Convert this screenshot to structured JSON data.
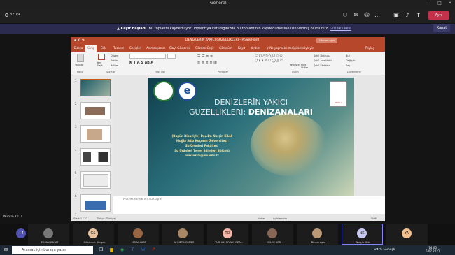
{
  "teams": {
    "window_title": "General",
    "timer": "32:19",
    "leave_label": "Ayrıl",
    "recording_bold": "Kayıt başladı.",
    "recording_text": "Bu toplantıı kaydediliyor. Toplantıya katıldığınızda bu toplantının kaydedilmesine izin vermiş olursunuz.",
    "recording_link": "Gizlilik ilkesi",
    "recording_close": "Kapat"
  },
  "ppt": {
    "title": "DENİZLERİN YAKICI GÜZELLİKLERİ - PowerPoint",
    "signin": "Oturum açın",
    "tabs": [
      "Dosya",
      "Giriş",
      "Ekle",
      "Tasarım",
      "Geçişler",
      "Animasyonlar",
      "Slayt Gösterisi",
      "Gözden Geçir",
      "Görünüm",
      "Kayıt",
      "Yardım"
    ],
    "search_hint": "Ne yapmak istediğinizi söyleyin",
    "share": "Paylaş",
    "ribbon_groups": [
      "Pano",
      "Slaytlar",
      "Yazı Tipi",
      "Paragraf",
      "Çizim",
      "Düzenleme"
    ],
    "ribbon_buttons": {
      "paste": "Yapıştır",
      "new_slide": "Yeni Slayt",
      "layout": "Düzen",
      "reset": "Sıfırla",
      "section": "Bölüm",
      "arrange": "Yerleştir",
      "quick_styles": "Hızlı Stiller",
      "fill": "Şekil Dolgusu",
      "outline": "Şekil Ana Hattı",
      "effects": "Şekil Efektleri",
      "find": "Bul",
      "replace": "Değiştir",
      "select": "Seç"
    },
    "slide_numbers": [
      "1",
      "2",
      "3",
      "4",
      "5",
      "6",
      "7"
    ],
    "notes_placeholder": "Not eklemek için tıklayın",
    "status": {
      "slide": "Slayt 1 / 27",
      "lang": "Türkçe (Türkiye)",
      "notes": "Notlar",
      "comments": "Açıklamalar",
      "zoom": "%66"
    }
  },
  "slide": {
    "title_line1": "DENİZLERİN YAKICI",
    "title_line2a": "GÜZELLİKLERİ: ",
    "title_line2b": "DENİZANALARI",
    "info": [
      "(Bugün itibariyle) Doç.Dr. Nurçin KILLI",
      "Muğla Sıtkı Koçman Üniversitesi",
      "Su Ürünleri Fakültesi",
      "Su Ürünleri Temel Bilimleri Bölümü",
      "nurcinkilli@mu.edu.tr"
    ],
    "logo2_letter": "e",
    "logo3_text": "MUĞLA"
  },
  "presenter": "Nurçin KILLI",
  "gallery": {
    "more": "+4",
    "participants": [
      {
        "name": "ERCAN KANAT",
        "initials": "",
        "color": "#777777"
      },
      {
        "name": "Güldemet Şimşek",
        "initials": "GS",
        "color": "#e8c39e"
      },
      {
        "name": "ESRA AKAT",
        "initials": "",
        "color": "#996644"
      },
      {
        "name": "AHMET MERMER",
        "initials": "",
        "color": "#aa8866"
      },
      {
        "name": "TURHAN ERCAN ÖZA...",
        "initials": "TO",
        "color": "#f4b6a8"
      },
      {
        "name": "MELEK BOR",
        "initials": "",
        "color": "#886655"
      },
      {
        "name": "Dincer Ayaz",
        "initials": "",
        "color": "#bb9977"
      },
      {
        "name": "Nurçin KILLI",
        "initials": "NK",
        "color": "#c7c9f0"
      },
      {
        "name": "",
        "initials": "YA",
        "color": "#f3c18f"
      }
    ]
  },
  "taskbar": {
    "search_placeholder": "Aramak için buraya yazın",
    "weather": "24°C Güneşli",
    "time": "14:05",
    "date": "6.07.2021"
  }
}
